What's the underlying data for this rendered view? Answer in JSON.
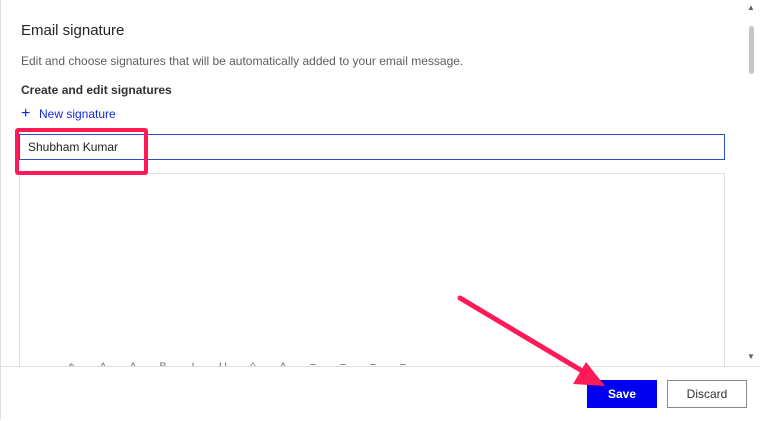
{
  "panel": {
    "title": "Email signature",
    "description": "Edit and choose signatures that will be automatically added to your email message.",
    "section_heading": "Create and edit signatures",
    "new_signature_label": "New signature",
    "signature_name_value": "Shubham Kumar"
  },
  "footer": {
    "save_label": "Save",
    "discard_label": "Discard"
  },
  "colors": {
    "accent": "#0000f0",
    "link": "#0f2ad8",
    "annotation": "#ff1a57"
  },
  "icons": {
    "add": "plus-icon",
    "scroll_up": "chevron-up-icon",
    "scroll_down": "chevron-down-icon"
  }
}
